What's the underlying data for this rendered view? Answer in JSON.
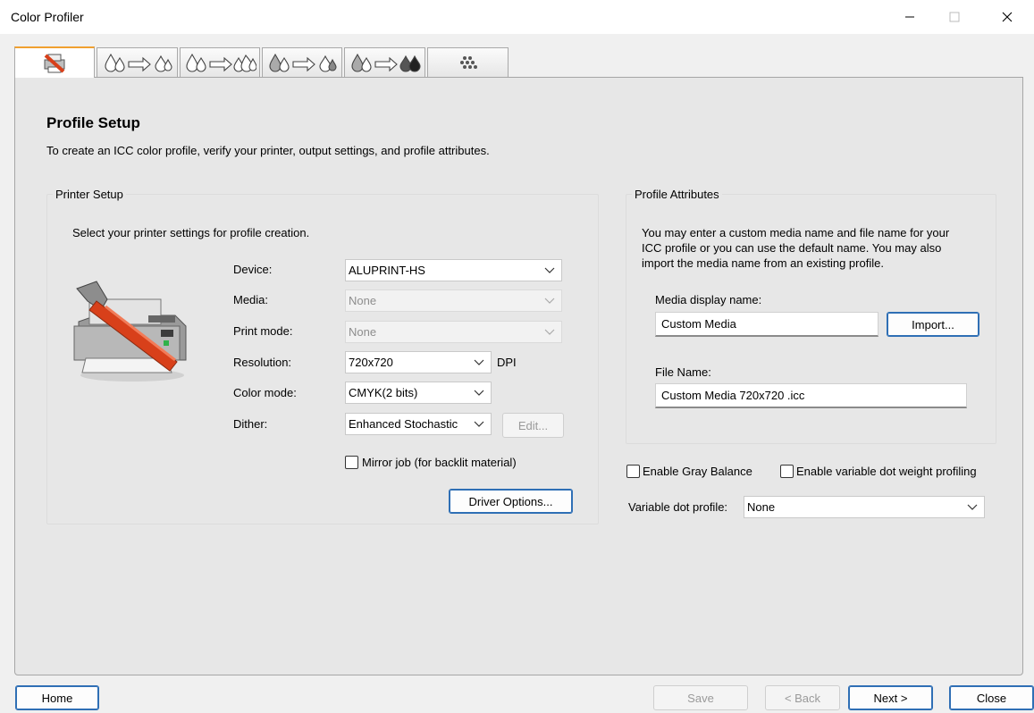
{
  "window": {
    "title": "Color Profiler"
  },
  "tabs": [
    {
      "icon": "printer-setup-icon"
    },
    {
      "icon": "ink-limit-icon"
    },
    {
      "icon": "linearization-icon"
    },
    {
      "icon": "ink-split-icon"
    },
    {
      "icon": "total-ink-icon"
    },
    {
      "icon": "color-patches-icon"
    }
  ],
  "page": {
    "title": "Profile Setup",
    "description": "To create an ICC color profile, verify your printer, output settings, and profile attributes."
  },
  "printer_setup": {
    "title": "Printer Setup",
    "instruction": "Select your printer settings for profile creation.",
    "device_label": "Device:",
    "device_value": "ALUPRINT-HS",
    "media_label": "Media:",
    "media_value": "None",
    "print_mode_label": "Print mode:",
    "print_mode_value": "None",
    "resolution_label": "Resolution:",
    "resolution_value": "720x720",
    "resolution_unit": "DPI",
    "color_mode_label": "Color mode:",
    "color_mode_value": "CMYK(2 bits)",
    "dither_label": "Dither:",
    "dither_value": "Enhanced Stochastic",
    "edit_button": "Edit...",
    "mirror_label": "Mirror job (for backlit material)",
    "driver_options_button": "Driver Options..."
  },
  "profile_attributes": {
    "title": "Profile Attributes",
    "description_line1": "You may enter a custom media name and file name for your",
    "description_line2": "ICC profile or you can use the default name. You may also",
    "description_line3": "import the media name from an existing profile.",
    "media_display_label": "Media display name:",
    "media_display_value": "Custom Media",
    "import_button": "Import...",
    "file_name_label": "File Name:",
    "file_name_value": "Custom Media 720x720 .icc"
  },
  "options": {
    "gray_balance_label": "Enable Gray Balance",
    "variable_dot_label": "Enable variable dot weight profiling",
    "variable_dot_profile_label": "Variable dot profile:",
    "variable_dot_profile_value": "None"
  },
  "footer": {
    "home": "Home",
    "save": "Save",
    "back": "< Back",
    "next": "Next >",
    "close": "Close"
  },
  "colors": {
    "accent": "#2f6fb5",
    "active_tab": "#f0a030"
  }
}
